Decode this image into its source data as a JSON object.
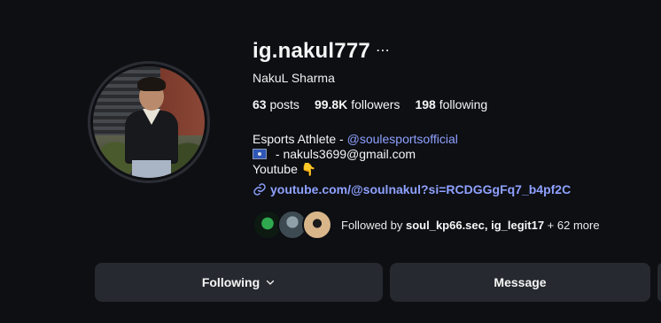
{
  "profile": {
    "username": "ig.nakul777",
    "full_name": "NakuL Sharma",
    "stats": {
      "posts_count": "63",
      "posts_label": "posts",
      "followers_count": "99.8K",
      "followers_label": "followers",
      "following_count": "198",
      "following_label": "following"
    },
    "bio": {
      "line1_prefix": "Esports Athlete - ",
      "line1_mention": "@soulesportsofficial",
      "line2_text": " - nakuls3699@gmail.com",
      "line3_text": "Youtube ",
      "line3_emoji": "👇"
    },
    "link": "youtube.com/@soulnakul?si=RCDGGgFq7_b4pf2C",
    "followed_by": {
      "prefix": "Followed by ",
      "users": "soul_kp66.sec, ig_legit17",
      "suffix": " + 62 more"
    }
  },
  "actions": {
    "following_label": "Following",
    "message_label": "Message"
  },
  "colors": {
    "background": "#0d0f13",
    "link": "#8fa1ff",
    "button": "#26292f"
  }
}
